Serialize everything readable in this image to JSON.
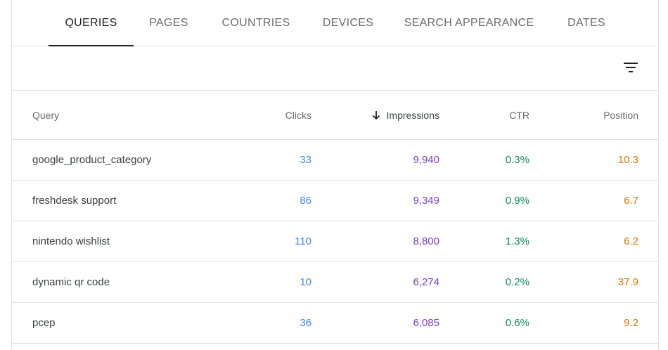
{
  "tabs": [
    {
      "label": "QUERIES",
      "active": true
    },
    {
      "label": "PAGES",
      "active": false
    },
    {
      "label": "COUNTRIES",
      "active": false
    },
    {
      "label": "DEVICES",
      "active": false
    },
    {
      "label": "SEARCH APPEARANCE",
      "active": false
    },
    {
      "label": "DATES",
      "active": false
    }
  ],
  "filter": {
    "icon": "filter-list-icon"
  },
  "table": {
    "columns": {
      "query": "Query",
      "clicks": "Clicks",
      "impressions": "Impressions",
      "ctr": "CTR",
      "position": "Position"
    },
    "sorted_by": "impressions",
    "sort_icon": "arrow-down-icon",
    "rows": [
      {
        "query": "google_product_category",
        "clicks": "33",
        "impressions": "9,940",
        "ctr": "0.3%",
        "position": "10.3"
      },
      {
        "query": "freshdesk support",
        "clicks": "86",
        "impressions": "9,349",
        "ctr": "0.9%",
        "position": "6.7"
      },
      {
        "query": "nintendo wishlist",
        "clicks": "110",
        "impressions": "8,800",
        "ctr": "1.3%",
        "position": "6.2"
      },
      {
        "query": "dynamic qr code",
        "clicks": "10",
        "impressions": "6,274",
        "ctr": "0.2%",
        "position": "37.9"
      },
      {
        "query": "pcep",
        "clicks": "36",
        "impressions": "6,085",
        "ctr": "0.6%",
        "position": "9.2"
      }
    ]
  },
  "colors": {
    "clicks": "#4285f4",
    "impressions": "#7b3fbf",
    "ctr": "#0d8a5f",
    "position": "#e37400"
  }
}
